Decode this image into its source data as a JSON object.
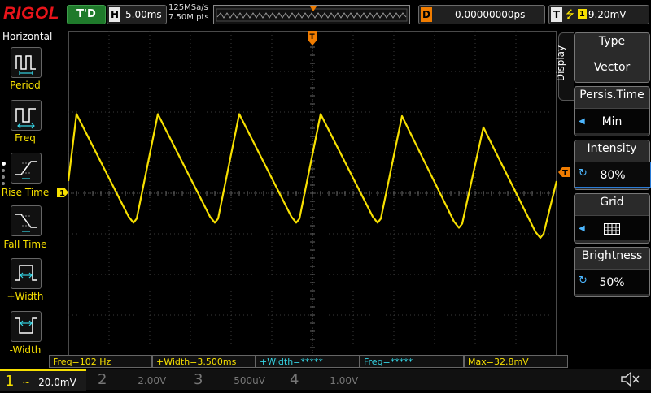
{
  "brand": "RIGOL",
  "status": "T'D",
  "horizontal": {
    "tag": "H",
    "timebase": "5.00ms"
  },
  "acquisition": {
    "sample_rate": "125MSa/s",
    "points": "7.50M pts"
  },
  "delay": {
    "tag": "D",
    "value": "0.00000000ps"
  },
  "trigger": {
    "tag": "T",
    "channel": "1",
    "level": "9.20mV",
    "slope_icon": "rising-edge-icon"
  },
  "left_menu": {
    "title": "Horizontal",
    "items": [
      {
        "label": "Period",
        "icon": "period-icon"
      },
      {
        "label": "Freq",
        "icon": "freq-icon"
      },
      {
        "label": "Rise Time",
        "icon": "rise-time-icon"
      },
      {
        "label": "Fall Time",
        "icon": "fall-time-icon"
      },
      {
        "label": "+Width",
        "icon": "positive-width-icon"
      },
      {
        "label": "-Width",
        "icon": "negative-width-icon"
      }
    ]
  },
  "right_menu": {
    "tab": "Display",
    "items": [
      {
        "title": "Type",
        "value": "Vector"
      },
      {
        "title": "Persis.Time",
        "value": "Min"
      },
      {
        "title": "Intensity",
        "value": "80%"
      },
      {
        "title": "Grid",
        "value": "",
        "icon": "grid-icon"
      },
      {
        "title": "Brightness",
        "value": "50%"
      }
    ]
  },
  "measurements": [
    "Freq=102 Hz",
    "+Width=3.500ms",
    "+Width=*****",
    "Freq=*****",
    "Max=32.8mV"
  ],
  "channels": [
    {
      "num": "1",
      "coupling": "~",
      "scale": "20.0mV"
    },
    {
      "num": "2",
      "scale": "2.00V"
    },
    {
      "num": "3",
      "scale": "500uV"
    },
    {
      "num": "4",
      "scale": "1.00V"
    }
  ],
  "markers": {
    "ch1": "1",
    "trigger_level": "T",
    "trigger_pos": "T"
  },
  "colors": {
    "ch1": "#f7e000",
    "trigger": "#f07c00",
    "accent_cyan": "#36d6e6",
    "brand": "#e8141a"
  },
  "waveform": {
    "type": "sawtooth",
    "frequency": "102 Hz",
    "peaks_ms": [
      1.0,
      11.0,
      21.0,
      31.0,
      41.0,
      51.0
    ],
    "troughs_ms": [
      8.0,
      18.0,
      28.0,
      38.0,
      48.0,
      58.0
    ],
    "peak_mV": [
      39.0,
      39.0,
      39.0,
      39.0,
      38.0,
      32.5
    ],
    "trough_mV": [
      -14.5,
      -14.5,
      -14.5,
      -14.5,
      -17.0,
      -22.0
    ],
    "time_per_div_ms": 5.0,
    "volts_per_div_mV": 20.0
  }
}
